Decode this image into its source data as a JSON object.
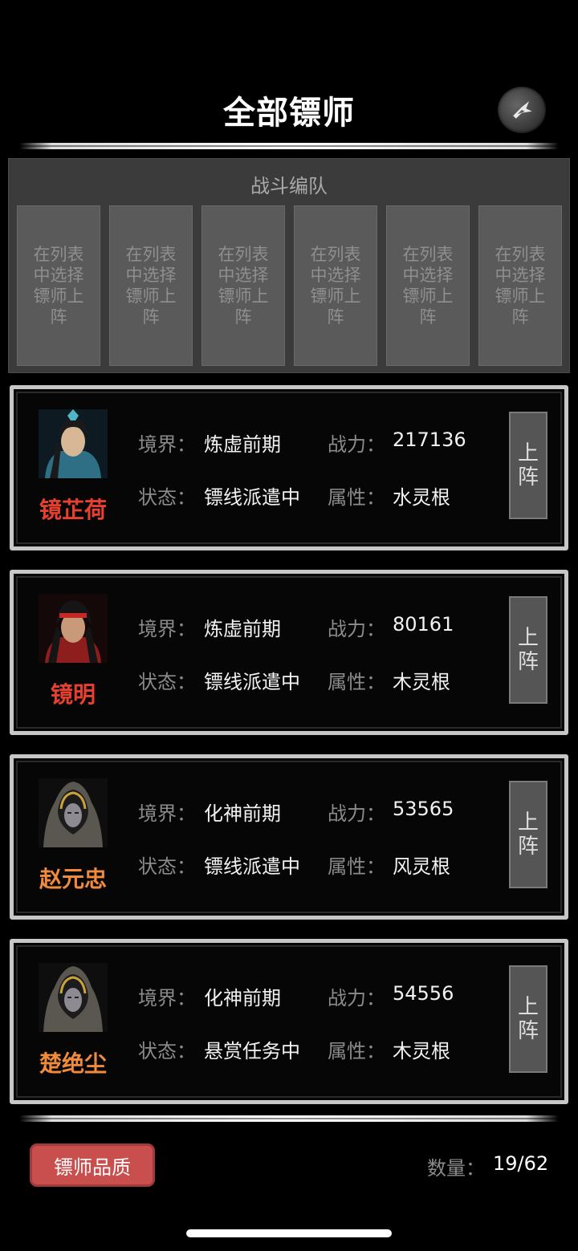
{
  "header": {
    "title": "全部镖师"
  },
  "team": {
    "title": "战斗编队",
    "slots": [
      "在列表中选择镖师上阵",
      "在列表中选择镖师上阵",
      "在列表中选择镖师上阵",
      "在列表中选择镖师上阵",
      "在列表中选择镖师上阵",
      "在列表中选择镖师上阵"
    ]
  },
  "labels": {
    "realm": "境界：",
    "power": "战力：",
    "status": "状态：",
    "attribute": "属性：",
    "deploy_top": "上",
    "deploy_bottom": "阵"
  },
  "heroes": [
    {
      "name": "镜芷荷",
      "name_color": "#e8402f",
      "realm": "炼虚前期",
      "power": "217136",
      "status": "镖线派遣中",
      "attribute": "水灵根",
      "avatar_icon": "warrior-blue-portrait-icon"
    },
    {
      "name": "镜明",
      "name_color": "#e8402f",
      "realm": "炼虚前期",
      "power": "80161",
      "status": "镖线派遣中",
      "attribute": "木灵根",
      "avatar_icon": "warrior-red-headband-portrait-icon"
    },
    {
      "name": "赵元忠",
      "name_color": "#f08a3c",
      "realm": "化神前期",
      "power": "53565",
      "status": "镖线派遣中",
      "attribute": "风灵根",
      "avatar_icon": "hooded-figure-portrait-icon"
    },
    {
      "name": "楚绝尘",
      "name_color": "#f08a3c",
      "realm": "化神前期",
      "power": "54556",
      "status": "悬赏任务中",
      "attribute": "木灵根",
      "avatar_icon": "hooded-figure-portrait-icon"
    }
  ],
  "footer": {
    "quality_button": "镖师品质",
    "count_label": "数量：",
    "count_value": "19/62"
  },
  "colors": {
    "background": "#000000",
    "panel": "#3b3b3b",
    "slot": "#5a5a5a",
    "accent_red": "#c94f4f"
  }
}
